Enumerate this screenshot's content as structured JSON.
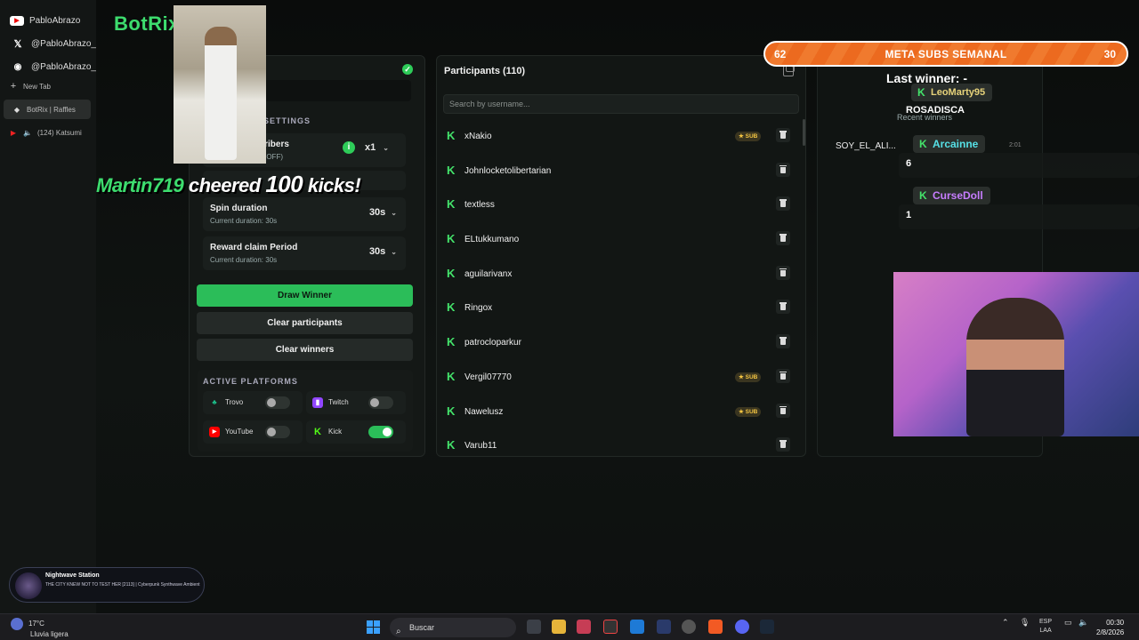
{
  "browser": {
    "pinned": [
      {
        "label": "PabloAbrazo",
        "icon": "youtube-icon"
      },
      {
        "label": "@PabloAbrazo_",
        "icon": "x-icon"
      },
      {
        "label": "@PabloAbrazo_",
        "icon": "discord-icon"
      }
    ],
    "new_tab": "New Tab",
    "tabs": [
      {
        "label": "BotRix | Raffles",
        "active": true
      },
      {
        "label": "(124) Katsumi",
        "active": false
      }
    ]
  },
  "brand": "BotRix",
  "settings": {
    "section_title": "SETTINGS",
    "subscribers": {
      "title": "scribers",
      "subtitle": "us (OFF)",
      "value": "x1"
    },
    "spin": {
      "title": "Spin duration",
      "subtitle": "Current duration: 30s",
      "value": "30s"
    },
    "claim": {
      "title": "Reward claim Period",
      "subtitle": "Current duration: 30s",
      "value": "30s"
    },
    "draw_button": "Draw Winner",
    "clear_participants_button": "Clear participants",
    "clear_winners_button": "Clear winners",
    "platforms_title": "ACTIVE PLATFORMS",
    "platforms": [
      {
        "name": "Trovo",
        "enabled": false,
        "color": "#1cc18c"
      },
      {
        "name": "Twitch",
        "enabled": false,
        "color": "#9146ff"
      },
      {
        "name": "YouTube",
        "enabled": false,
        "color": "#ff0000"
      },
      {
        "name": "Kick",
        "enabled": true,
        "color": "#53fc18"
      }
    ]
  },
  "participants": {
    "title": "Participants (110)",
    "search_placeholder": "Search by username...",
    "sub_label": "★ SUB",
    "rows": [
      {
        "name": "xNakio",
        "sub": true
      },
      {
        "name": "Johnlocketolibertarian",
        "sub": false
      },
      {
        "name": "textless",
        "sub": false
      },
      {
        "name": "ELtukkumano",
        "sub": false
      },
      {
        "name": "aguilarivanx",
        "sub": false
      },
      {
        "name": "Ringox",
        "sub": false
      },
      {
        "name": "patrocloparkur",
        "sub": false
      },
      {
        "name": "Vergil07770",
        "sub": true
      },
      {
        "name": "Nawelusz",
        "sub": true
      },
      {
        "name": "Varub11",
        "sub": false
      }
    ]
  },
  "winners": {
    "last_winner": "Last winner: -",
    "recent_label": "Recent winners",
    "recent_user": "SOY_EL_ALI...",
    "recent_time": "2:01"
  },
  "overlay": {
    "goal": {
      "left": "62",
      "center": "META SUBS SEMANAL",
      "right": "30"
    },
    "cheer": {
      "nick": "Martin719",
      "text": " cheered ",
      "amount": "100",
      "suffix": " kicks!"
    },
    "chat": [
      {
        "name": "LeoMarty95",
        "msg": "ROSADISCA",
        "color": "#e6d27a"
      },
      {
        "name": "Arcainne",
        "msg": "6",
        "color": "#56e0e6"
      },
      {
        "name": "CurseDoll",
        "msg": "1",
        "color": "#c77dff"
      }
    ]
  },
  "music": {
    "station": "Nightwave Station",
    "track": "THE CITY KNEW NOT TO TEST HER [2113] | Cyberpunk Synthwave Ambient"
  },
  "taskbar": {
    "temp": "17°C",
    "weather": "Lluvia ligera",
    "search": "Buscar",
    "lang1": "ESP",
    "lang2": "LAA",
    "time": "00:30",
    "date": "2/8/2026"
  }
}
